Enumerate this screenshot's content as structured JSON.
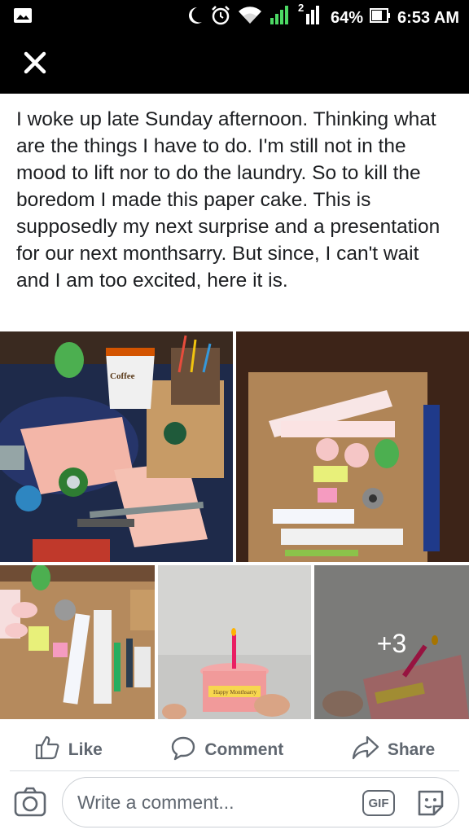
{
  "status_bar": {
    "battery": "64%",
    "time": "6:53 AM",
    "sim_badge": "2",
    "icons": [
      "gallery-icon",
      "moon-icon",
      "alarm-icon",
      "wifi-icon",
      "signal-icon",
      "battery-icon"
    ]
  },
  "header": {
    "close_icon": "close-icon"
  },
  "post": {
    "text": "I woke up late Sunday afternoon. Thinking what are the things I have to do. I'm still not in the mood to lift nor to do the laundry. So to kill the boredom I made this paper cake. This is supposedly my next surprise and a presentation for our next monthsarry. But since, I can't wait and I am too excited, here it is."
  },
  "photos": {
    "mug_text": "Coffee",
    "cake_text": "Happy Monthsarry",
    "more_count": "+3"
  },
  "actions": {
    "like": "Like",
    "comment": "Comment",
    "share": "Share"
  },
  "composer": {
    "placeholder": "Write a comment...",
    "gif_label": "GIF"
  },
  "colors": {
    "status_bar": "#000000",
    "text": "#1c1e21",
    "secondary": "#606770",
    "divider": "#dadde1"
  }
}
